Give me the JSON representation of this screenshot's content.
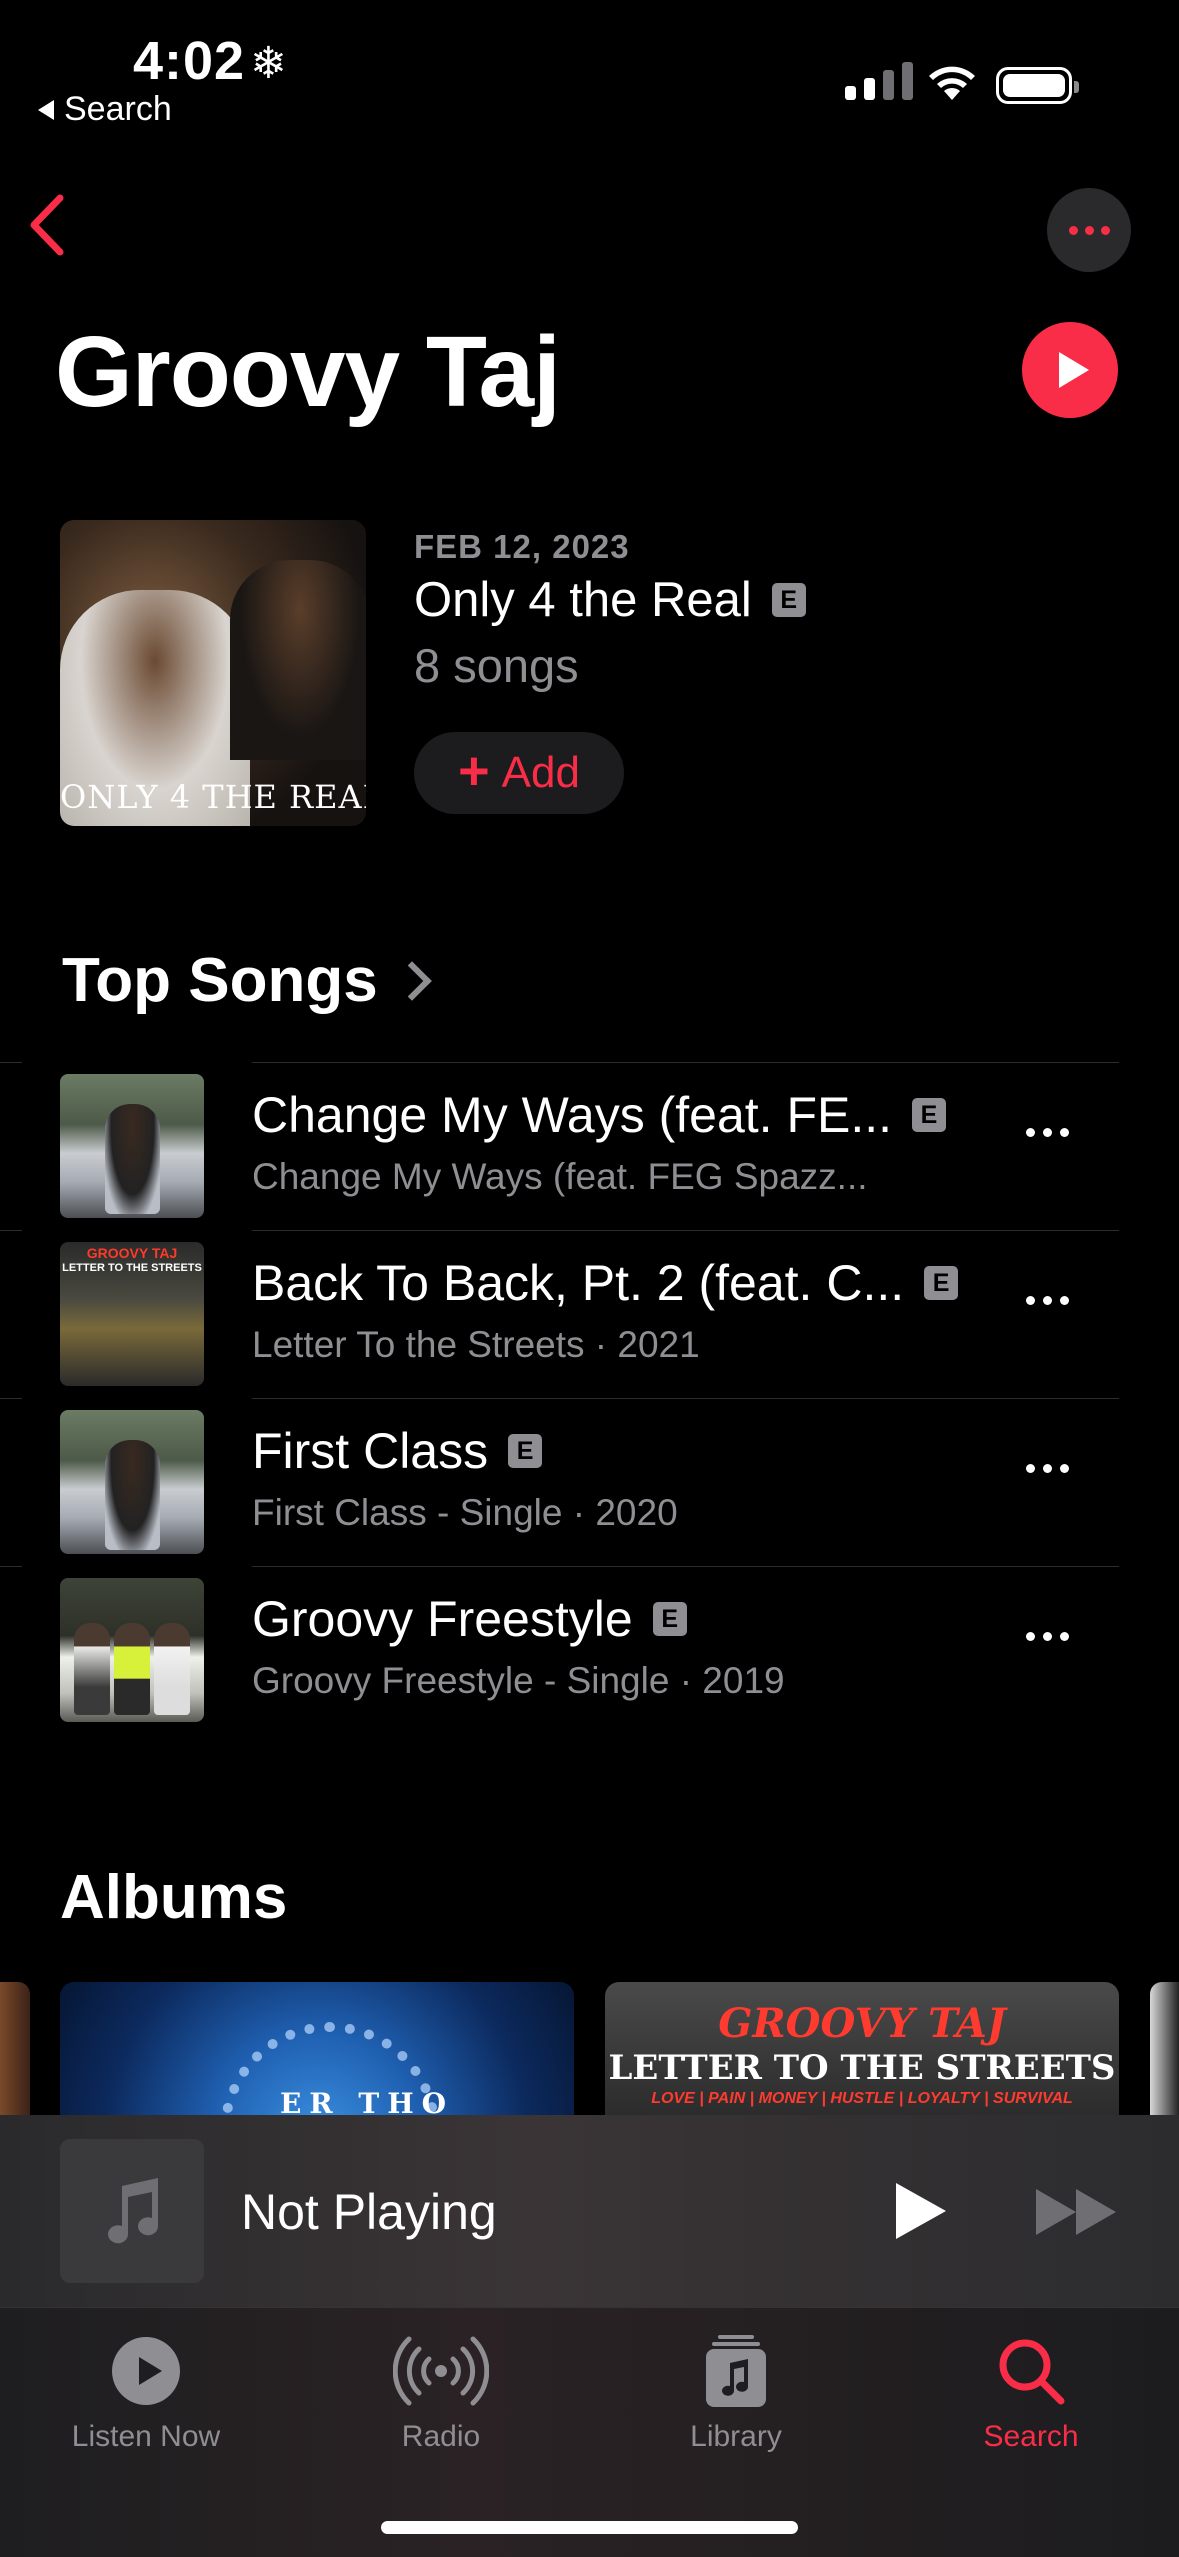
{
  "status_bar": {
    "time": "4:02",
    "back_label": "Search"
  },
  "artist": {
    "name": "Groovy Taj"
  },
  "latest_release": {
    "date": "FEB 12, 2023",
    "title": "Only 4 the Real",
    "explicit": "E",
    "song_count": "8 songs",
    "cover_text": "ONLY 4 THE REAL",
    "add_label": "Add"
  },
  "top_songs": {
    "title": "Top Songs",
    "items": [
      {
        "title": "Change My Ways (feat. FE...",
        "subtitle": "Change My Ways (feat. FEG Spazz...",
        "explicit": "E"
      },
      {
        "title": "Back To Back, Pt. 2 (feat. C...",
        "subtitle": "Letter To the Streets · 2021",
        "explicit": "E"
      },
      {
        "title": "First Class",
        "subtitle": "First Class - Single · 2020",
        "explicit": "E"
      },
      {
        "title": "Groovy Freestyle",
        "subtitle": "Groovy Freestyle - Single · 2019",
        "explicit": "E"
      }
    ]
  },
  "albums": {
    "title": "Albums",
    "items": [
      {
        "cover_text": "ER THO"
      },
      {
        "cover_title": "GROOVY TAJ",
        "cover_subtitle": "LETTER TO THE STREETS",
        "cover_tagline": "LOVE | PAIN | MONEY | HUSTLE | LOYALTY | SURVIVAL"
      }
    ]
  },
  "mini_player": {
    "label": "Not Playing"
  },
  "tab_bar": {
    "tabs": [
      {
        "label": "Listen Now",
        "icon": "play-circle-icon"
      },
      {
        "label": "Radio",
        "icon": "radio-icon"
      },
      {
        "label": "Library",
        "icon": "library-icon"
      },
      {
        "label": "Search",
        "icon": "search-icon"
      }
    ],
    "active": "Search"
  },
  "colors": {
    "accent": "#fa2d48",
    "background": "#000000",
    "secondary_text": "#8e8e93"
  }
}
